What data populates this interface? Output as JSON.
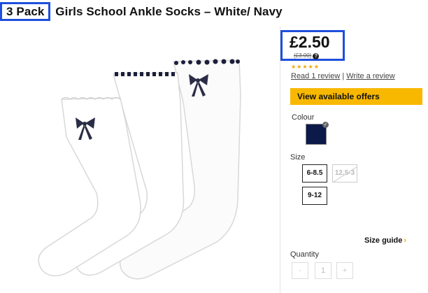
{
  "product": {
    "pack_label": "3 Pack",
    "title_rest": " Girls School Ankle Socks – White/ Navy"
  },
  "pricing": {
    "price": "£2.50",
    "was_price": "(£3.00)",
    "info_icon": "?"
  },
  "rating": {
    "stars": "★★★★★",
    "read_reviews": "Read 1 review",
    "separator": "|",
    "write_review": "Write a review"
  },
  "offers_button": "View available offers",
  "colour": {
    "label": "Colour",
    "selected_color": "#0c1a4a"
  },
  "size": {
    "label": "Size",
    "options": [
      "6-8.5",
      "12.5-3",
      "9-12"
    ],
    "unavailable": "12.5-3",
    "guide": "Size guide",
    "guide_arrow": "›"
  },
  "quantity": {
    "label": "Quantity",
    "minus": "-",
    "value": "1",
    "plus": "+"
  }
}
